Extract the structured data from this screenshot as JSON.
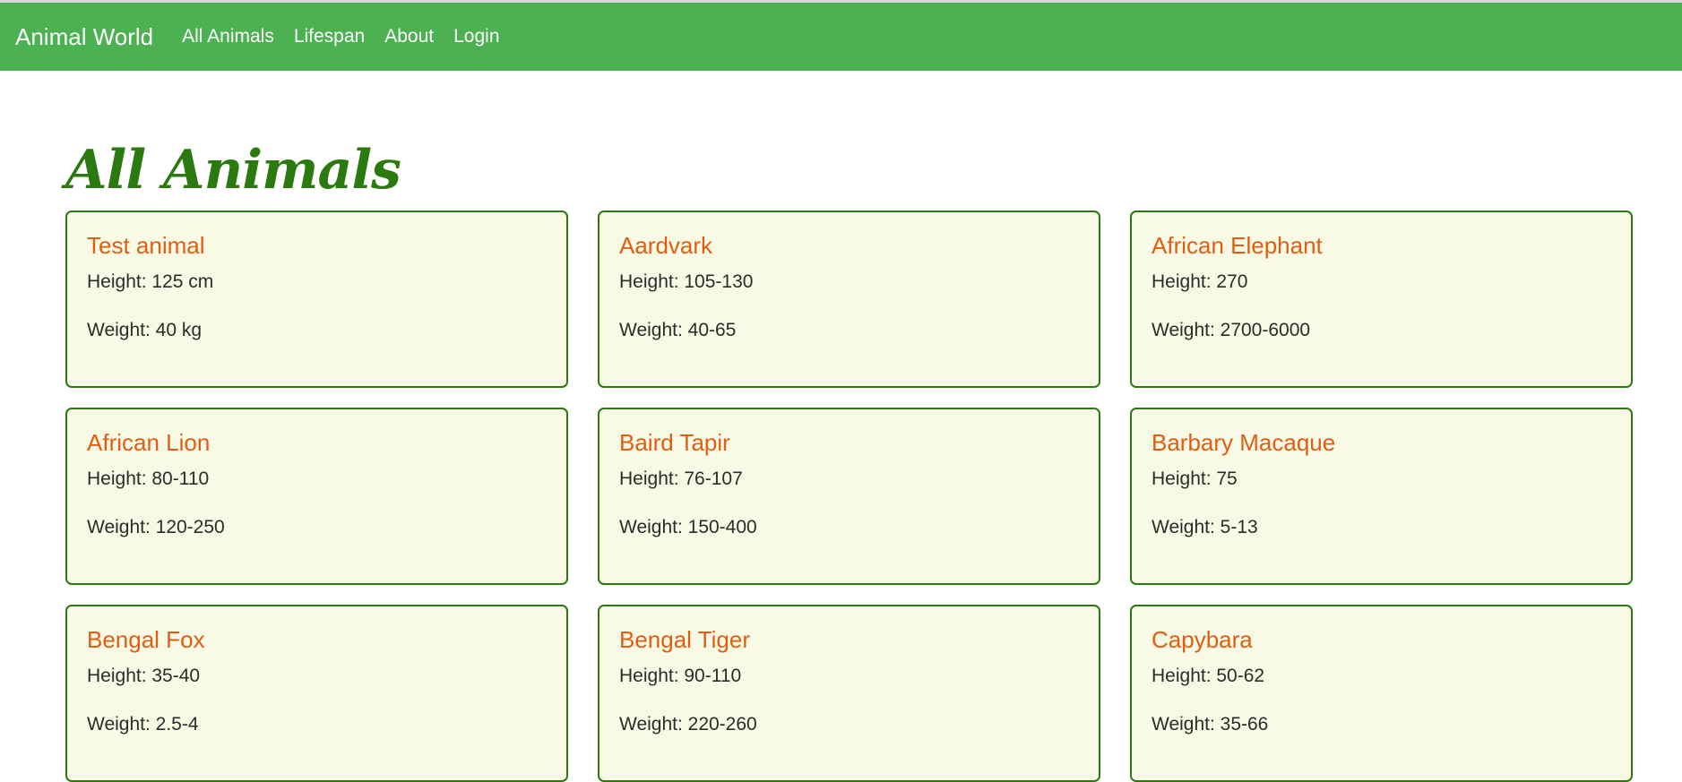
{
  "nav": {
    "brand": "Animal World",
    "links": [
      "All Animals",
      "Lifespan",
      "About",
      "Login"
    ]
  },
  "page": {
    "title": "All Animals"
  },
  "animals": [
    {
      "name": "Test animal",
      "height": "Height: 125 cm",
      "weight": "Weight: 40 kg"
    },
    {
      "name": "Aardvark",
      "height": "Height: 105-130",
      "weight": "Weight: 40-65"
    },
    {
      "name": "African Elephant",
      "height": "Height: 270",
      "weight": "Weight: 2700-6000"
    },
    {
      "name": "African Lion",
      "height": "Height: 80-110",
      "weight": "Weight: 120-250"
    },
    {
      "name": "Baird Tapir",
      "height": "Height: 76-107",
      "weight": "Weight: 150-400"
    },
    {
      "name": "Barbary Macaque",
      "height": "Height: 75",
      "weight": "Weight: 5-13"
    },
    {
      "name": "Bengal Fox",
      "height": "Height: 35-40",
      "weight": "Weight: 2.5-4"
    },
    {
      "name": "Bengal Tiger",
      "height": "Height: 90-110",
      "weight": "Weight: 220-260"
    },
    {
      "name": "Capybara",
      "height": "Height: 50-62",
      "weight": "Weight: 35-66"
    }
  ],
  "colors": {
    "navbar": "#4cb151",
    "title": "#2a7a10",
    "card_bg": "#f8fae6",
    "card_border": "#2a7a10",
    "animal_name": "#e05d12"
  }
}
